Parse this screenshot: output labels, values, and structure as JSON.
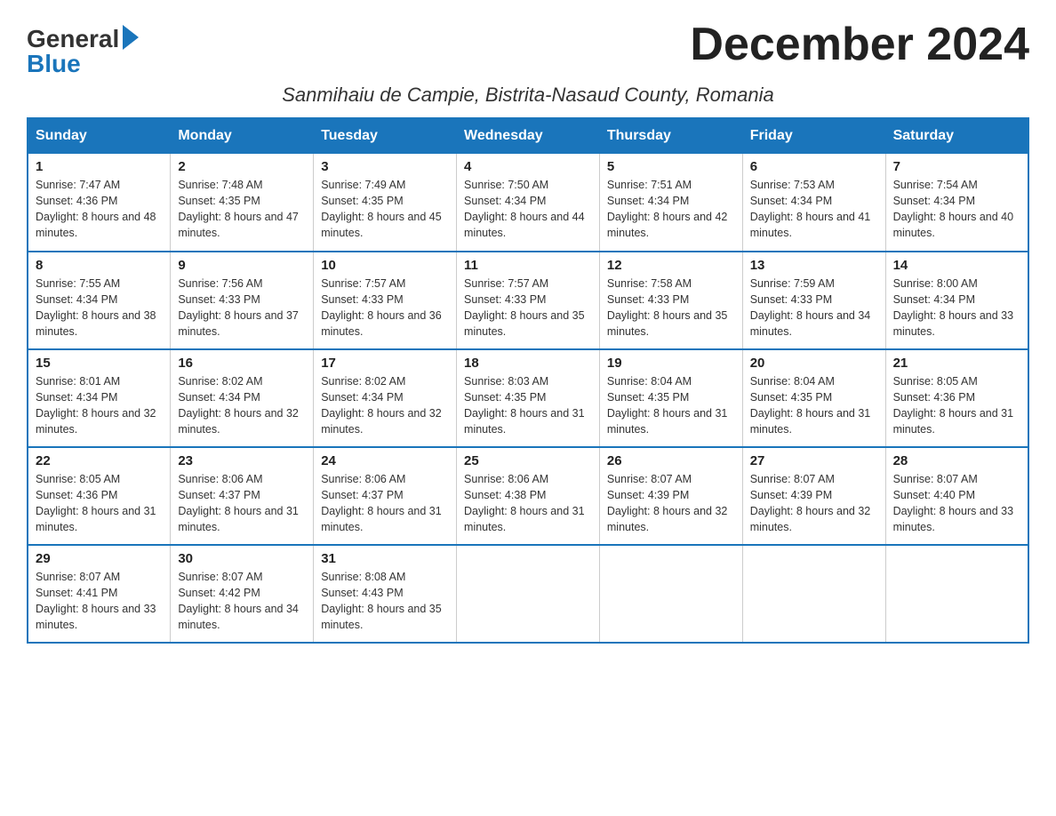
{
  "header": {
    "month_title": "December 2024",
    "subtitle": "Sanmihaiu de Campie, Bistrita-Nasaud County, Romania",
    "logo_general": "General",
    "logo_blue": "Blue"
  },
  "days_of_week": [
    "Sunday",
    "Monday",
    "Tuesday",
    "Wednesday",
    "Thursday",
    "Friday",
    "Saturday"
  ],
  "weeks": [
    [
      {
        "day": "1",
        "sunrise": "7:47 AM",
        "sunset": "4:36 PM",
        "daylight": "8 hours and 48 minutes."
      },
      {
        "day": "2",
        "sunrise": "7:48 AM",
        "sunset": "4:35 PM",
        "daylight": "8 hours and 47 minutes."
      },
      {
        "day": "3",
        "sunrise": "7:49 AM",
        "sunset": "4:35 PM",
        "daylight": "8 hours and 45 minutes."
      },
      {
        "day": "4",
        "sunrise": "7:50 AM",
        "sunset": "4:34 PM",
        "daylight": "8 hours and 44 minutes."
      },
      {
        "day": "5",
        "sunrise": "7:51 AM",
        "sunset": "4:34 PM",
        "daylight": "8 hours and 42 minutes."
      },
      {
        "day": "6",
        "sunrise": "7:53 AM",
        "sunset": "4:34 PM",
        "daylight": "8 hours and 41 minutes."
      },
      {
        "day": "7",
        "sunrise": "7:54 AM",
        "sunset": "4:34 PM",
        "daylight": "8 hours and 40 minutes."
      }
    ],
    [
      {
        "day": "8",
        "sunrise": "7:55 AM",
        "sunset": "4:34 PM",
        "daylight": "8 hours and 38 minutes."
      },
      {
        "day": "9",
        "sunrise": "7:56 AM",
        "sunset": "4:33 PM",
        "daylight": "8 hours and 37 minutes."
      },
      {
        "day": "10",
        "sunrise": "7:57 AM",
        "sunset": "4:33 PM",
        "daylight": "8 hours and 36 minutes."
      },
      {
        "day": "11",
        "sunrise": "7:57 AM",
        "sunset": "4:33 PM",
        "daylight": "8 hours and 35 minutes."
      },
      {
        "day": "12",
        "sunrise": "7:58 AM",
        "sunset": "4:33 PM",
        "daylight": "8 hours and 35 minutes."
      },
      {
        "day": "13",
        "sunrise": "7:59 AM",
        "sunset": "4:33 PM",
        "daylight": "8 hours and 34 minutes."
      },
      {
        "day": "14",
        "sunrise": "8:00 AM",
        "sunset": "4:34 PM",
        "daylight": "8 hours and 33 minutes."
      }
    ],
    [
      {
        "day": "15",
        "sunrise": "8:01 AM",
        "sunset": "4:34 PM",
        "daylight": "8 hours and 32 minutes."
      },
      {
        "day": "16",
        "sunrise": "8:02 AM",
        "sunset": "4:34 PM",
        "daylight": "8 hours and 32 minutes."
      },
      {
        "day": "17",
        "sunrise": "8:02 AM",
        "sunset": "4:34 PM",
        "daylight": "8 hours and 32 minutes."
      },
      {
        "day": "18",
        "sunrise": "8:03 AM",
        "sunset": "4:35 PM",
        "daylight": "8 hours and 31 minutes."
      },
      {
        "day": "19",
        "sunrise": "8:04 AM",
        "sunset": "4:35 PM",
        "daylight": "8 hours and 31 minutes."
      },
      {
        "day": "20",
        "sunrise": "8:04 AM",
        "sunset": "4:35 PM",
        "daylight": "8 hours and 31 minutes."
      },
      {
        "day": "21",
        "sunrise": "8:05 AM",
        "sunset": "4:36 PM",
        "daylight": "8 hours and 31 minutes."
      }
    ],
    [
      {
        "day": "22",
        "sunrise": "8:05 AM",
        "sunset": "4:36 PM",
        "daylight": "8 hours and 31 minutes."
      },
      {
        "day": "23",
        "sunrise": "8:06 AM",
        "sunset": "4:37 PM",
        "daylight": "8 hours and 31 minutes."
      },
      {
        "day": "24",
        "sunrise": "8:06 AM",
        "sunset": "4:37 PM",
        "daylight": "8 hours and 31 minutes."
      },
      {
        "day": "25",
        "sunrise": "8:06 AM",
        "sunset": "4:38 PM",
        "daylight": "8 hours and 31 minutes."
      },
      {
        "day": "26",
        "sunrise": "8:07 AM",
        "sunset": "4:39 PM",
        "daylight": "8 hours and 32 minutes."
      },
      {
        "day": "27",
        "sunrise": "8:07 AM",
        "sunset": "4:39 PM",
        "daylight": "8 hours and 32 minutes."
      },
      {
        "day": "28",
        "sunrise": "8:07 AM",
        "sunset": "4:40 PM",
        "daylight": "8 hours and 33 minutes."
      }
    ],
    [
      {
        "day": "29",
        "sunrise": "8:07 AM",
        "sunset": "4:41 PM",
        "daylight": "8 hours and 33 minutes."
      },
      {
        "day": "30",
        "sunrise": "8:07 AM",
        "sunset": "4:42 PM",
        "daylight": "8 hours and 34 minutes."
      },
      {
        "day": "31",
        "sunrise": "8:08 AM",
        "sunset": "4:43 PM",
        "daylight": "8 hours and 35 minutes."
      },
      null,
      null,
      null,
      null
    ]
  ]
}
